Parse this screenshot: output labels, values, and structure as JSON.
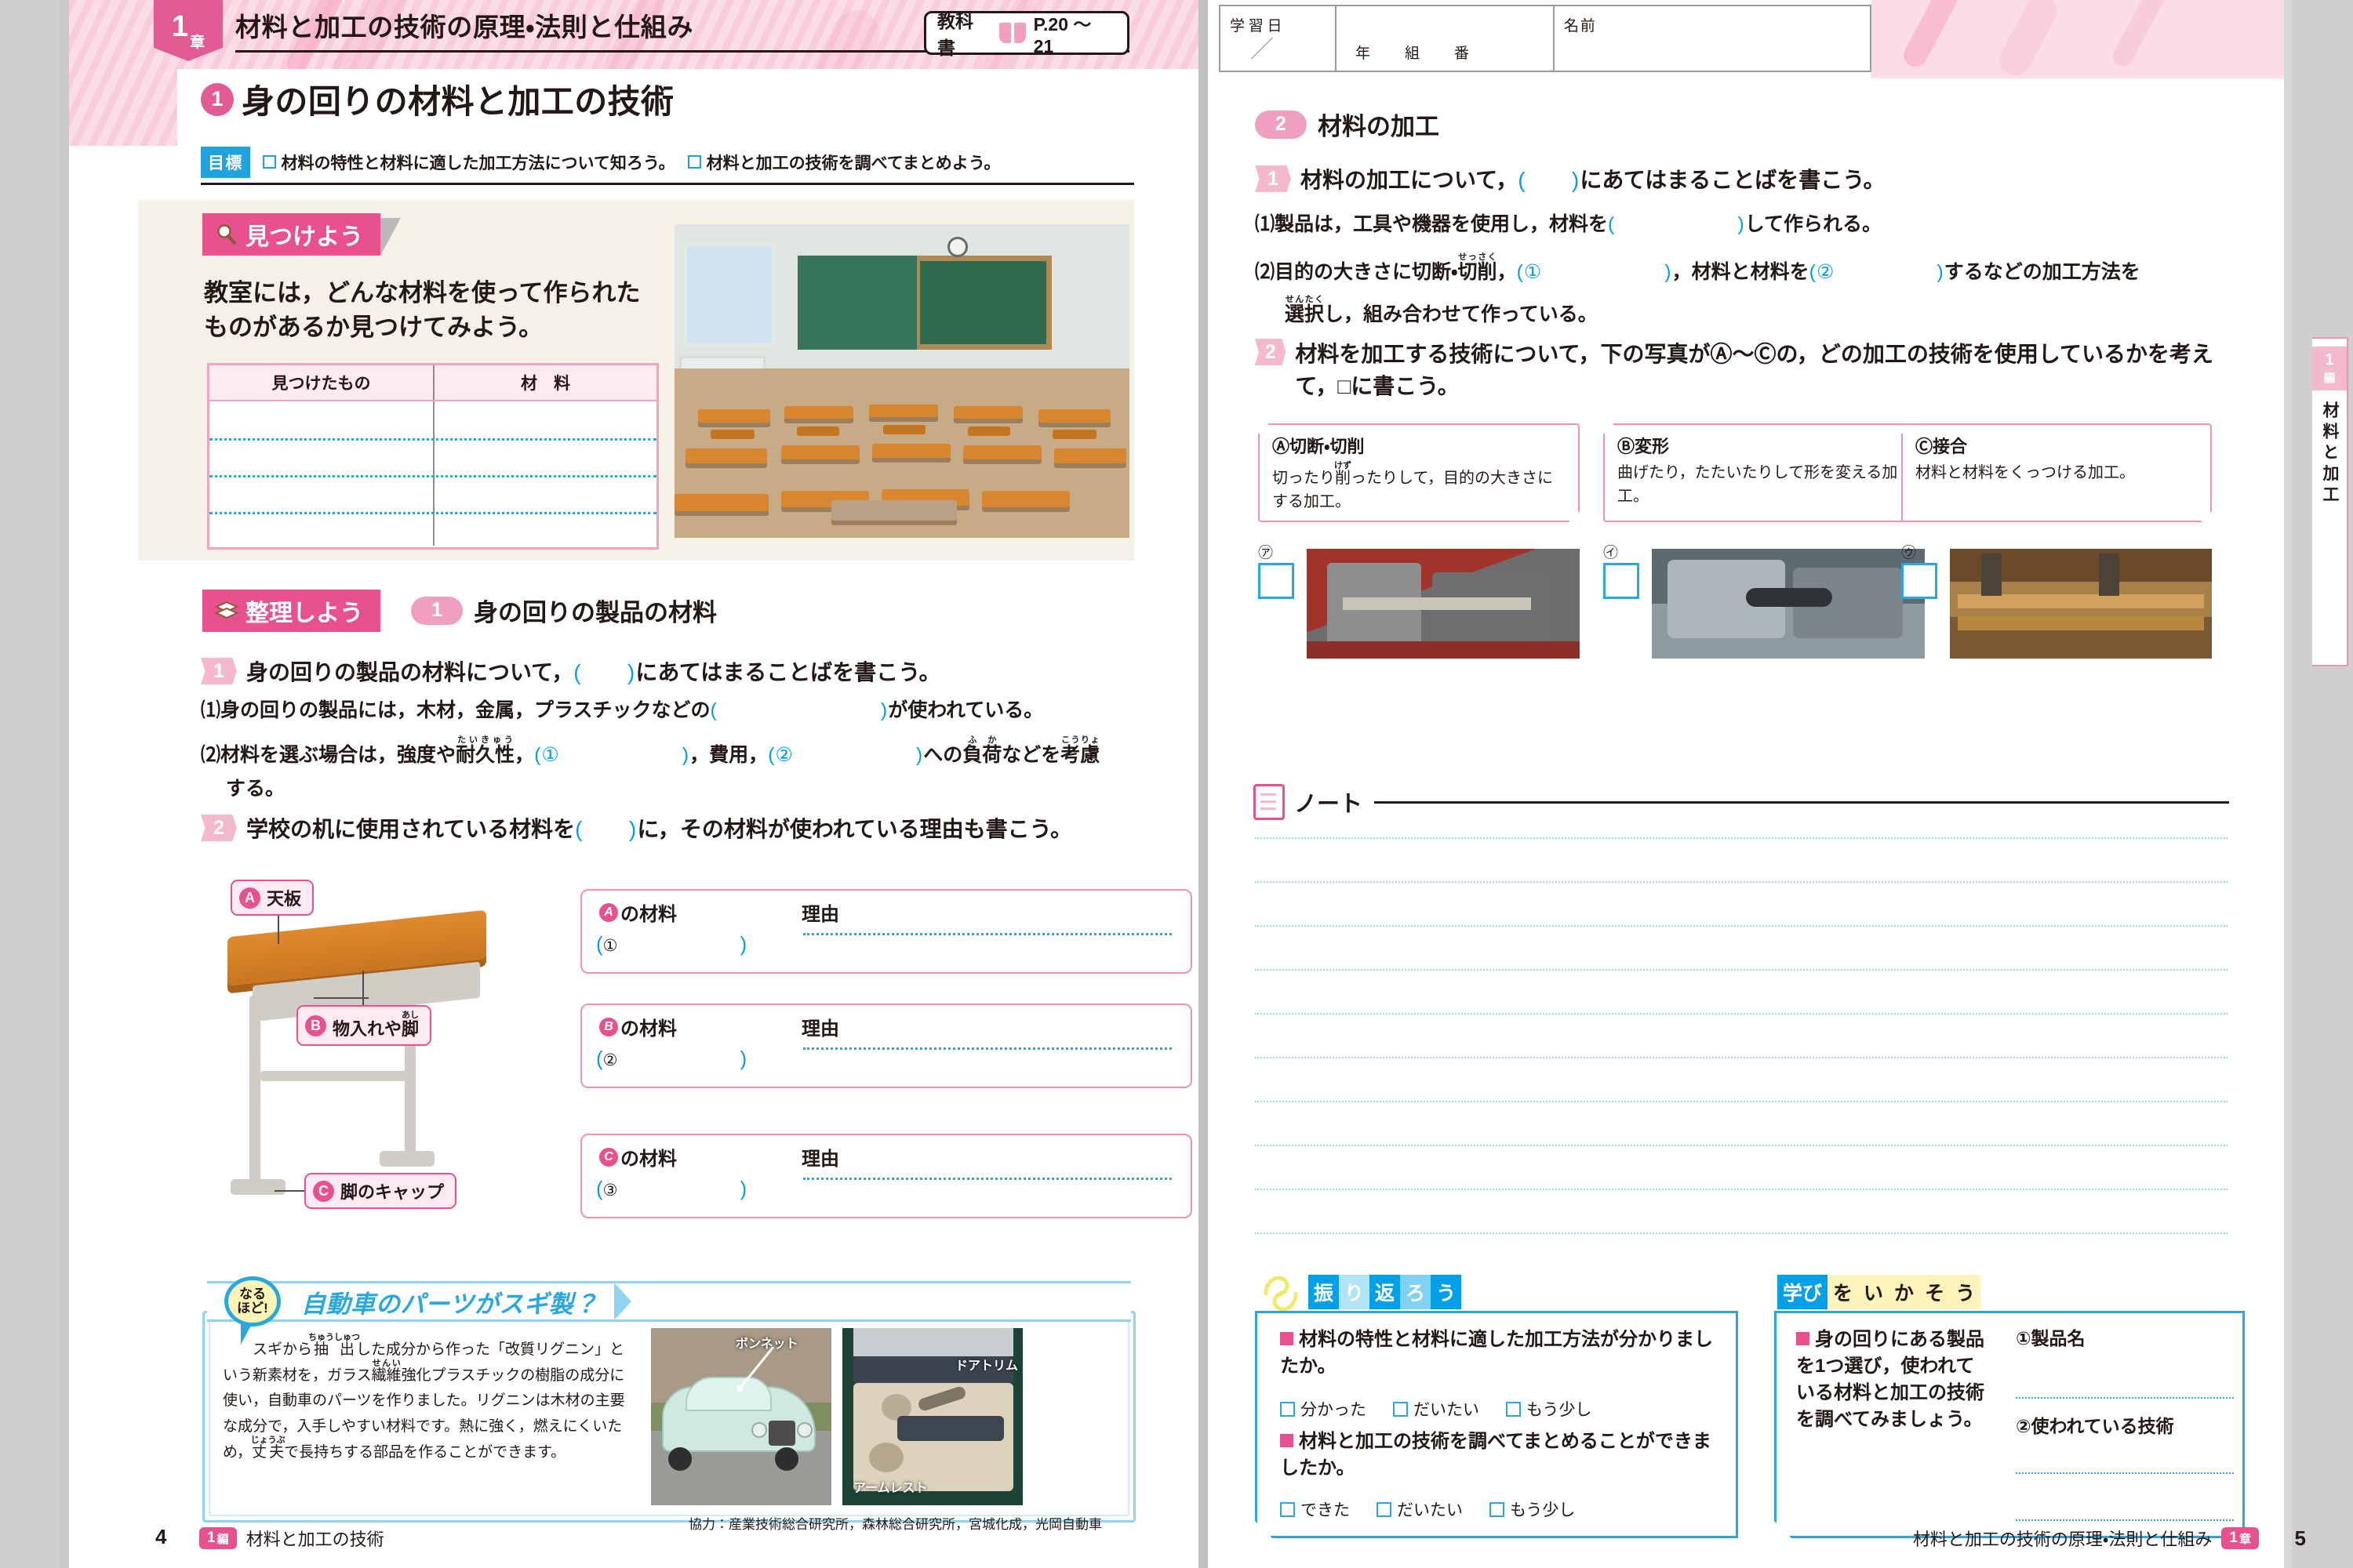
{
  "left_page": {
    "chapter_tag": {
      "number": "1",
      "unit": "章"
    },
    "chapter_title": "材料と加工の技術の原理・法則と仕組み",
    "textbook_ref": {
      "label": "教科書",
      "pages": "P.20 ～ 21"
    },
    "main_title": {
      "number": "1",
      "text": "身の回りの材料と加工の技術"
    },
    "goals": {
      "tag": "目標",
      "items": [
        "材料の特性と材料に適した加工方法について知ろう。",
        "材料と加工の技術を調べてまとめよう。"
      ]
    },
    "find_section": {
      "tab_label": "見つけよう",
      "tab_icon": "magnifier-icon",
      "prompt": "教室には，どんな材料を使って作られたものがあるか見つけてみよう。",
      "table": {
        "headers": [
          "見つけたもの",
          "材　料"
        ],
        "rows": [
          "",
          "",
          "",
          ""
        ]
      },
      "photo_caption": "classroom-photo"
    },
    "organize_section": {
      "tab_label": "整理しよう",
      "tab_icon": "layers-icon",
      "sub_number": "1",
      "sub_title": "身の回りの製品の材料",
      "q1": {
        "number": "1",
        "text_a": "身の回りの製品の材料について，",
        "blank": "(　　)",
        "text_b": "にあてはまることばを書こう。"
      },
      "q1_items": [
        {
          "marker": "⑴",
          "parts": [
            "身の回りの製品には，木材，金属，プラスチックなどの",
            "(　　　　　　　　)",
            "が使われている。"
          ]
        },
        {
          "marker": "⑵",
          "parts": [
            "材料を選ぶ場合は，強度や耐久性，",
            "(①　　　　　　)",
            "，費用，",
            "(②　　　　　　)",
            "への負荷などを考慮する。"
          ]
        }
      ],
      "ruby": {
        "taikyu": "たいきゅう",
        "fuka": "ふか",
        "koryo": "こうりょ"
      },
      "q2": {
        "number": "2",
        "text_a": "学校の机に使用されている材料を",
        "blank": "(　　)",
        "text_b": "に，その材料が使われている理由も書こう。"
      },
      "desk_labels": [
        {
          "key": "A",
          "label": "天板"
        },
        {
          "key": "B",
          "label": "物入れや脚",
          "ruby": "あし"
        },
        {
          "key": "C",
          "label": "脚のキャップ"
        }
      ],
      "answer_boxes": [
        {
          "key": "A",
          "material_label": "の材料",
          "index": "①",
          "reason_label": "理由"
        },
        {
          "key": "B",
          "material_label": "の材料",
          "index": "②",
          "reason_label": "理由"
        },
        {
          "key": "C",
          "material_label": "の材料",
          "index": "③",
          "reason_label": "理由"
        }
      ]
    },
    "column": {
      "bubble": [
        "なる",
        "ほど!"
      ],
      "title": "自動車のパーツがスギ製？",
      "body": "スギから抽出した成分から作った「改質リグニン」という新素材を，ガラス繊維強化プラスチックの樹脂の成分に使い，自動車のパーツを作りました。リグニンは木材の主要な成分で，入手しやすい材料です。熱に強く，燃えにくいため，丈夫で長持ちする部品を作ることができます。",
      "ruby": {
        "chushutsu": "ちゅうしゅつ",
        "seni": "せんい",
        "jobu": "じょうぶ"
      },
      "photo_labels": [
        "ボンネット",
        "ドアトリム",
        "アームレスト"
      ],
      "credit": "協力：産業技術総合研究所，森林総合研究所，宮城化成，光岡自動車"
    },
    "footer": {
      "page": "4",
      "tag_num": "1",
      "tag_unit": "編",
      "text": "材料と加工の技術"
    }
  },
  "right_page": {
    "name_header": {
      "date_label": "学習日",
      "slash": "／",
      "year": "年",
      "class": "組",
      "number": "番",
      "name_label": "名前"
    },
    "section": {
      "number": "2",
      "title": "材料の加工"
    },
    "q1": {
      "number": "1",
      "text_a": "材料の加工について，",
      "blank": "(　　)",
      "text_b": "にあてはまることばを書こう。"
    },
    "q1_items": [
      {
        "marker": "⑴",
        "text": "製品は，工具や機器を使用し，材料を(　　　　　　)して作られる。"
      },
      {
        "marker": "⑵",
        "text": "目的の大きさに切断・切削，(①　　　　　　)，材料と材料を(②　　　　　)するなどの加工方法を選択し，組み合わせて作っている。"
      }
    ],
    "ruby": {
      "sessaku": "せっさく",
      "senta": "せんたく"
    },
    "q2": {
      "number": "2",
      "text": "材料を加工する技術について，下の写真がⒶ～Ⓒの，どの加工の技術を使用しているかを考えて，□に書こう。"
    },
    "tech_cards": [
      {
        "key": "Ⓐ",
        "title": "Ⓐ切断・切削",
        "ruby": "けず",
        "desc": "切ったり削ったりして，目的の大きさにする加工。"
      },
      {
        "key": "Ⓑ",
        "title": "Ⓑ変形",
        "desc": "曲げたり，たたいたりして形を変える加工。"
      },
      {
        "key": "Ⓒ",
        "title": "Ⓒ接合",
        "desc": "材料と材料をくっつける加工。"
      }
    ],
    "photo_markers": [
      "㋐",
      "㋑",
      "㋒"
    ],
    "note": {
      "title": "ノート",
      "icon": "note-icon",
      "line_count": 11
    },
    "side_tab": {
      "edition": "1",
      "edition_label": "編",
      "vertical_text": "材料と加工"
    },
    "reflect": {
      "icon": "reflect-icon",
      "title_chars": [
        "振",
        "り",
        "返",
        "ろ",
        "う"
      ],
      "items": [
        {
          "question": "材料の特性と材料に適した加工方法が分かりましたか。",
          "options": [
            "分かった",
            "だいたい",
            "もう少し"
          ]
        },
        {
          "question": "材料と加工の技術を調べてまとめることができましたか。",
          "options": [
            "できた",
            "だいたい",
            "もう少し"
          ]
        }
      ]
    },
    "use_learning": {
      "title_chars": [
        "学び",
        "を",
        "い",
        "か",
        "そ",
        "う"
      ],
      "prompt": "身の回りにある製品を1つ選び，使われている材料と加工の技術を調べてみましょう。",
      "fields": [
        {
          "index": "①",
          "label": "製品名"
        },
        {
          "index": "②",
          "label": "使われている技術"
        }
      ]
    },
    "footer": {
      "text": "材料と加工の技術の原理・法則と仕組み",
      "tag_num": "1",
      "tag_unit": "章",
      "page": "5"
    }
  },
  "colors": {
    "pink": "#e8518d",
    "pink_light": "#f4b9ce",
    "pink_pale": "#fdeaf2",
    "blue": "#00a0e9",
    "blue_light": "#8fd4f2",
    "cream": "#f6f1e7",
    "ink": "#231815"
  }
}
